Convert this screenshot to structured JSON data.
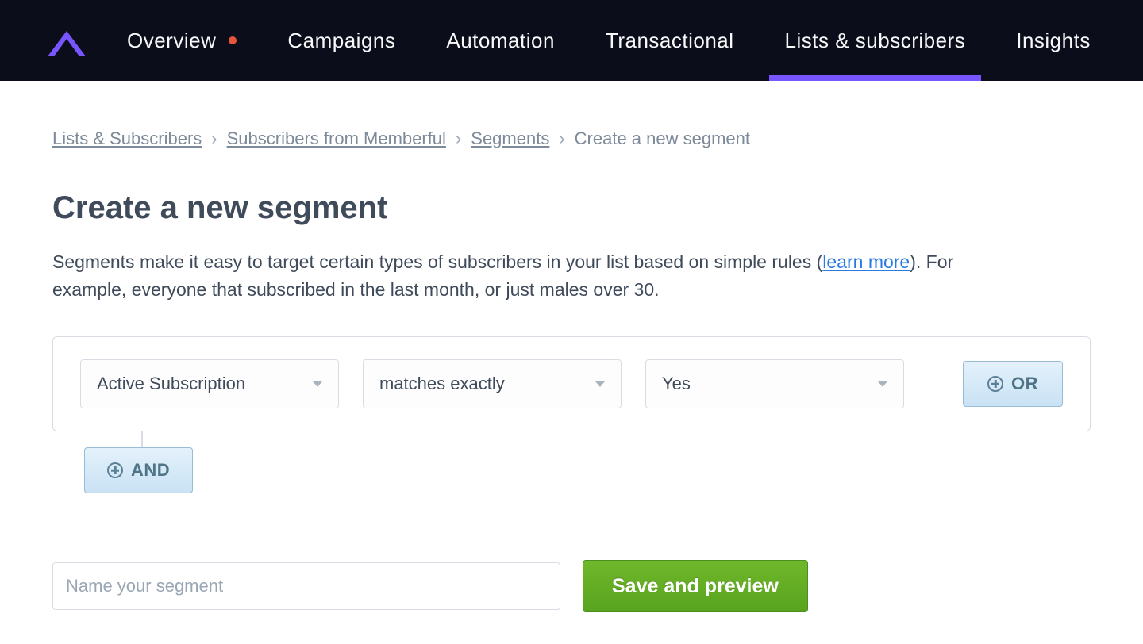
{
  "nav": {
    "items": [
      {
        "label": "Overview",
        "slug": "overview",
        "has_dot": true
      },
      {
        "label": "Campaigns",
        "slug": "campaigns",
        "has_dot": false
      },
      {
        "label": "Automation",
        "slug": "automation",
        "has_dot": false
      },
      {
        "label": "Transactional",
        "slug": "transactional",
        "has_dot": false
      },
      {
        "label": "Lists & subscribers",
        "slug": "lists",
        "has_dot": false,
        "active": true
      },
      {
        "label": "Insights",
        "slug": "insights",
        "has_dot": false
      }
    ]
  },
  "breadcrumb": {
    "items": [
      {
        "label": "Lists & Subscribers",
        "link": true
      },
      {
        "label": "Subscribers from Memberful",
        "link": true
      },
      {
        "label": "Segments",
        "link": true
      },
      {
        "label": "Create a new segment",
        "link": false
      }
    ],
    "separator": "›"
  },
  "page": {
    "title": "Create a new segment",
    "intro_before_link": "Segments make it easy to target certain types of subscribers in your list based on simple rules (",
    "learn_more": "learn more",
    "intro_after_link": "). For example, everyone that subscribed in the last month, or just males over 30."
  },
  "rule": {
    "field": "Active Subscription",
    "operator": "matches exactly",
    "value": "Yes",
    "or_label": "OR",
    "and_label": "AND"
  },
  "form": {
    "name_placeholder": "Name your segment",
    "name_value": "",
    "save_label": "Save and preview"
  }
}
